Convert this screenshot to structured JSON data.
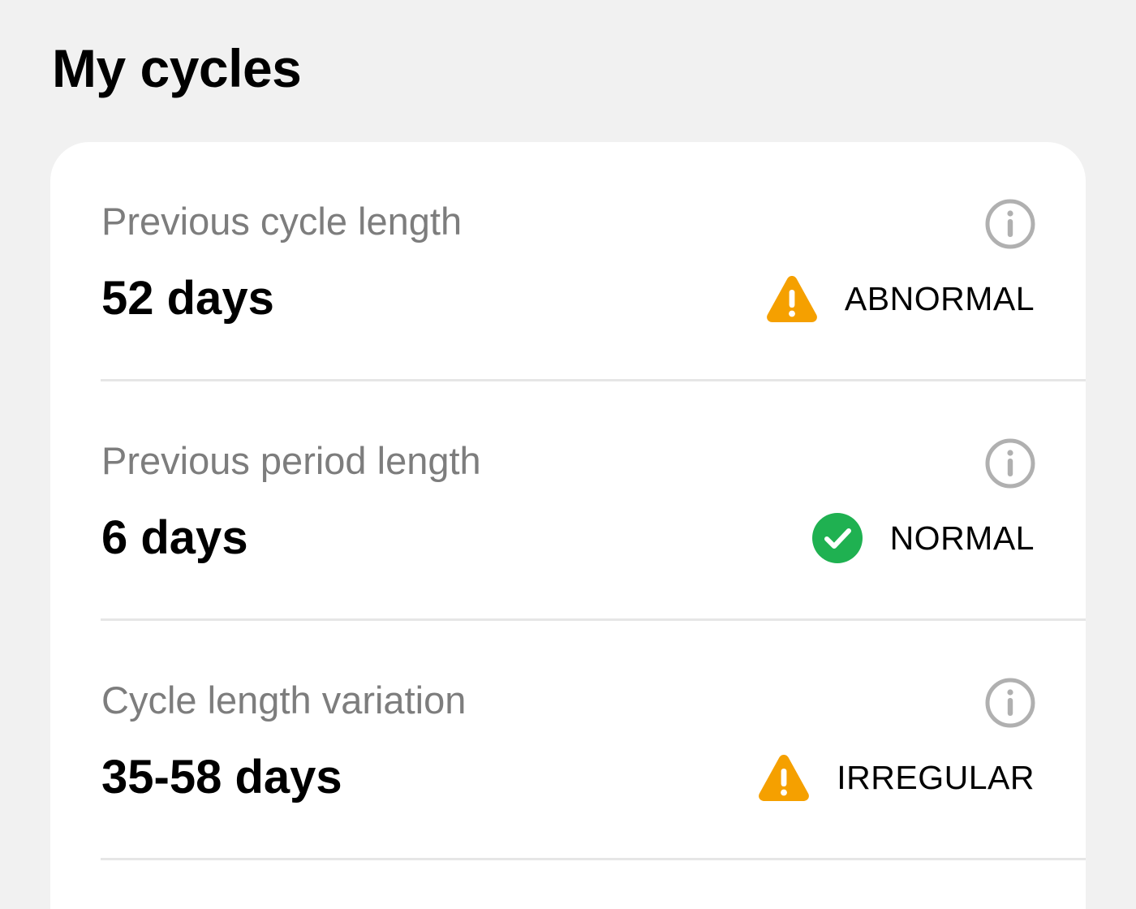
{
  "page": {
    "title": "My cycles"
  },
  "colors": {
    "warning": "#f5a000",
    "success": "#1fb151",
    "label_gray": "#7d7d7d",
    "info_icon_gray": "#b0b0b0"
  },
  "metrics": [
    {
      "label": "Previous cycle length",
      "value": "52 days",
      "status": "ABNORMAL",
      "status_icon": "warning-icon",
      "info_icon": "info-icon"
    },
    {
      "label": "Previous period length",
      "value": "6 days",
      "status": "NORMAL",
      "status_icon": "check-circle-icon",
      "info_icon": "info-icon"
    },
    {
      "label": "Cycle length variation",
      "value": "35-58 days",
      "status": "IRREGULAR",
      "status_icon": "warning-icon",
      "info_icon": "info-icon"
    }
  ]
}
